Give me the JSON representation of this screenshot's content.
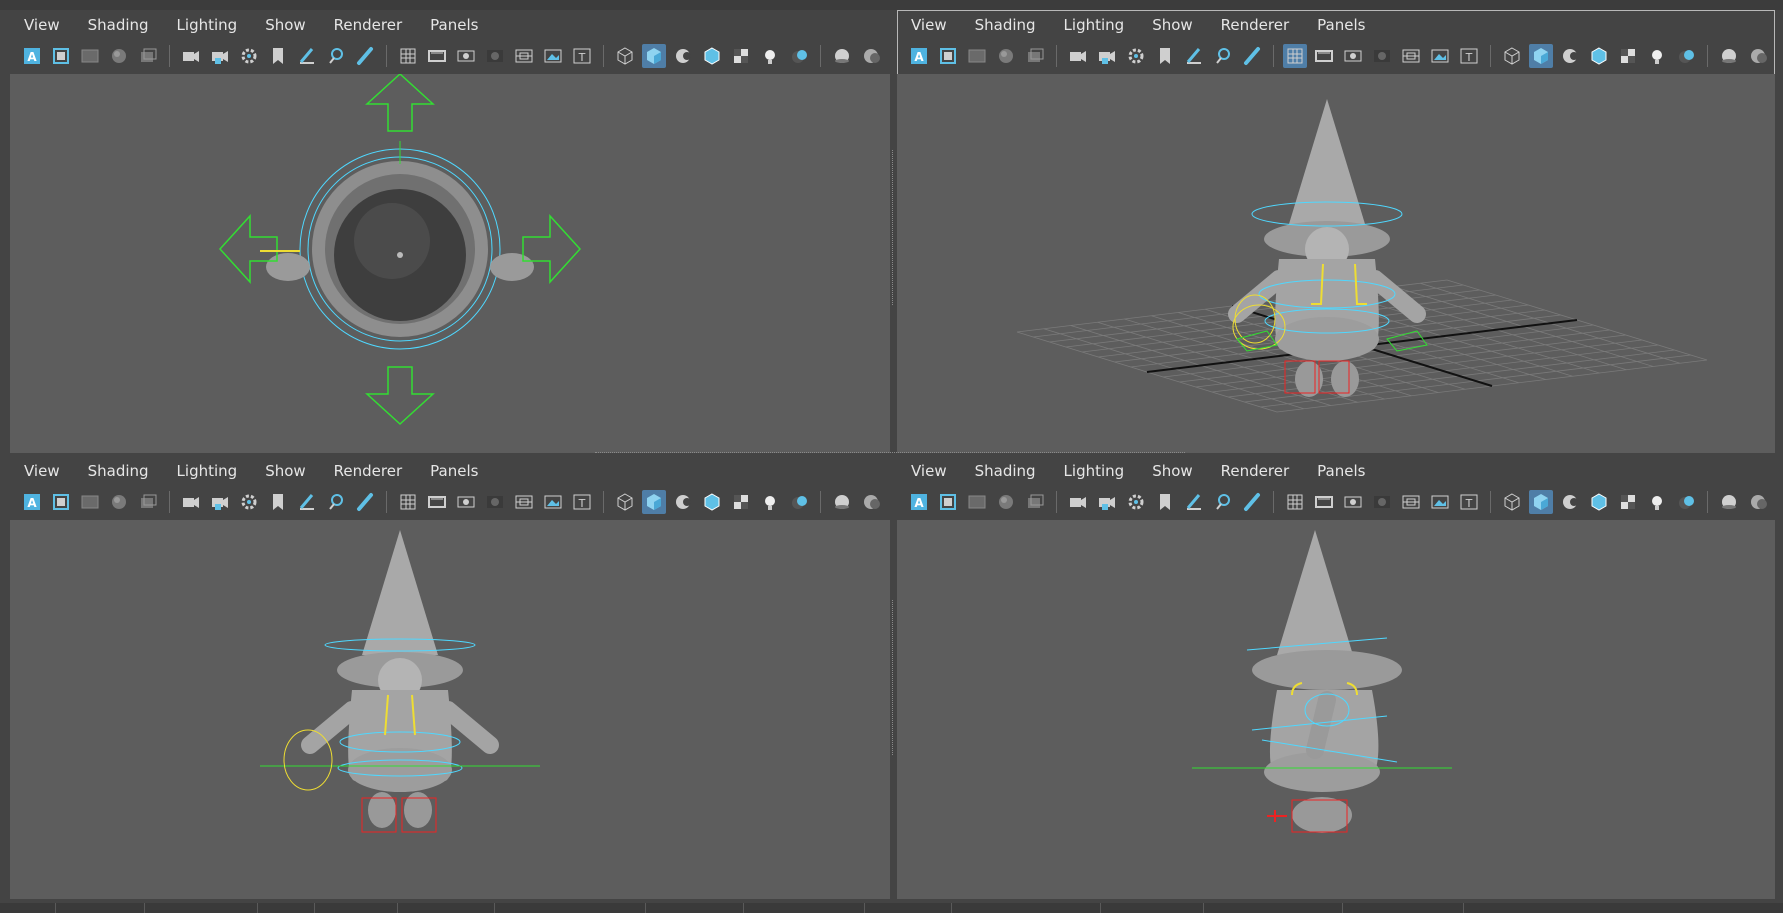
{
  "menus": [
    "View",
    "Shading",
    "Lighting",
    "Show",
    "Renderer",
    "Panels"
  ],
  "toolbar_icons": [
    "select-camera-icon",
    "camera-attributes-icon",
    "bookmarks-icon",
    "image-plane-icon",
    "2d-pan-zoom-icon",
    "sep",
    "camera-icon",
    "camera-lock-icon",
    "camera-settings-icon",
    "bookmark-icon",
    "grease-pencil-icon",
    "pan-zoom-icon",
    "paint-icon",
    "sep",
    "grid-icon",
    "film-gate-icon",
    "resolution-gate-icon",
    "gate-mask-icon",
    "field-chart-icon",
    "safe-action-icon",
    "safe-title-icon",
    "sep",
    "wireframe-icon",
    "smooth-shade-icon",
    "wireframe-on-shaded-icon",
    "textured-icon",
    "use-all-lights-icon",
    "shadows-icon",
    "ambient-occlusion-icon",
    "sep",
    "xray-icon",
    "xray-joints-icon"
  ],
  "panels": {
    "top": {
      "name": "top",
      "active": false
    },
    "persp": {
      "name": "persp",
      "active": true
    },
    "front": {
      "name": "front",
      "active": false
    },
    "side": {
      "name": "side",
      "active": false
    }
  },
  "colors": {
    "viewport_bg": "#5d5d5d",
    "model": "#a9a9a9",
    "control_cyan": "#4fd8ff",
    "control_green": "#33dd33",
    "control_yellow": "#eedd33",
    "control_red": "#ee2222",
    "accent": "#4f7ea7"
  }
}
